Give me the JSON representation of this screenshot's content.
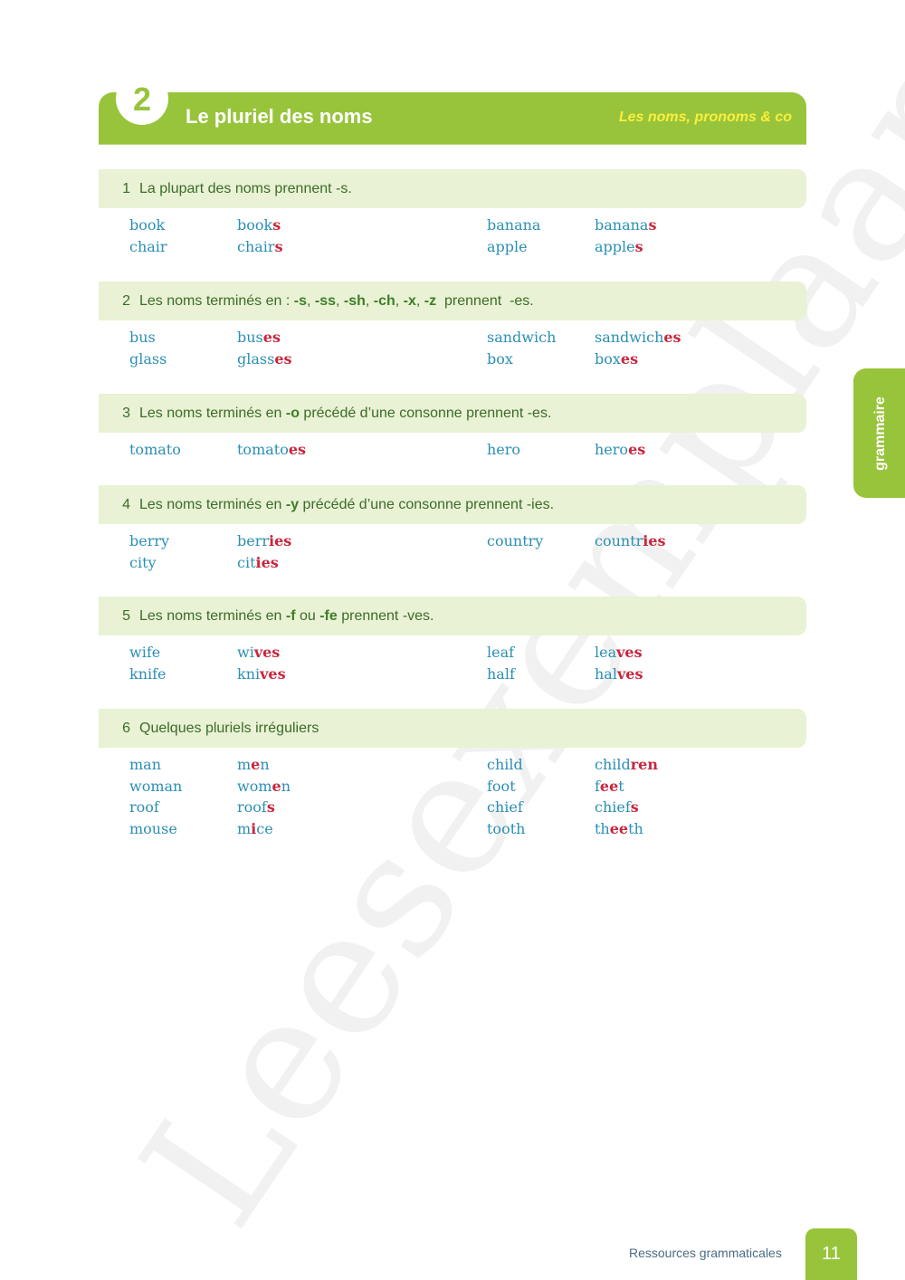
{
  "watermark": "Leesexemplaar",
  "header": {
    "number": "2",
    "title": "Le pluriel des noms",
    "subtitle": "Les noms, pronoms & co"
  },
  "side_tab": "grammaire",
  "sections": [
    {
      "num": "1",
      "rule_parts": [
        {
          "t": "La plupart des noms prennent -s.",
          "b": false
        }
      ],
      "rows": [
        [
          {
            "base": "book"
          },
          {
            "stem": "book",
            "end": "s"
          },
          {
            "base": "banana"
          },
          {
            "stem": "banana",
            "end": "s"
          }
        ],
        [
          {
            "base": "chair"
          },
          {
            "stem": "chair",
            "end": "s"
          },
          {
            "base": "apple"
          },
          {
            "stem": "apple",
            "end": "s"
          }
        ]
      ]
    },
    {
      "num": "2",
      "rule_parts": [
        {
          "t": "Les noms terminés en : ",
          "b": false
        },
        {
          "t": "-s",
          "b": true
        },
        {
          "t": ", ",
          "b": false
        },
        {
          "t": "-ss",
          "b": true
        },
        {
          "t": ", ",
          "b": false
        },
        {
          "t": "-sh",
          "b": true
        },
        {
          "t": ", ",
          "b": false
        },
        {
          "t": "-ch",
          "b": true
        },
        {
          "t": ", ",
          "b": false
        },
        {
          "t": "-x",
          "b": true
        },
        {
          "t": ", ",
          "b": false
        },
        {
          "t": "-z",
          "b": true
        },
        {
          "t": "  prennent  -es.",
          "b": false
        }
      ],
      "rows": [
        [
          {
            "base": "bus"
          },
          {
            "stem": "bus",
            "end": "es"
          },
          {
            "base": "sandwich"
          },
          {
            "stem": "sandwich",
            "end": "es"
          }
        ],
        [
          {
            "base": "glass"
          },
          {
            "stem": "glass",
            "end": "es"
          },
          {
            "base": "box"
          },
          {
            "stem": "box",
            "end": "es"
          }
        ]
      ]
    },
    {
      "num": "3",
      "rule_parts": [
        {
          "t": "Les noms terminés en ",
          "b": false
        },
        {
          "t": "-o",
          "b": true
        },
        {
          "t": " précédé d’une consonne prennent -es.",
          "b": false
        }
      ],
      "rows": [
        [
          {
            "base": "tomato"
          },
          {
            "stem": "tomato",
            "end": "es"
          },
          {
            "base": "hero"
          },
          {
            "stem": "hero",
            "end": "es"
          }
        ]
      ]
    },
    {
      "num": "4",
      "rule_parts": [
        {
          "t": "Les noms terminés en ",
          "b": false
        },
        {
          "t": "-y",
          "b": true
        },
        {
          "t": " précédé d’une consonne prennent -ies.",
          "b": false
        }
      ],
      "rows": [
        [
          {
            "base": "berry"
          },
          {
            "stem": "berr",
            "end": "ies"
          },
          {
            "base": "country"
          },
          {
            "stem": "countr",
            "end": "ies"
          }
        ],
        [
          {
            "base": "city"
          },
          {
            "stem": "cit",
            "end": "ies"
          },
          null,
          null
        ]
      ]
    },
    {
      "num": "5",
      "rule_parts": [
        {
          "t": "Les noms terminés en ",
          "b": false
        },
        {
          "t": "-f",
          "b": true
        },
        {
          "t": " ou ",
          "b": false
        },
        {
          "t": "-fe",
          "b": true
        },
        {
          "t": " prennent -ves.",
          "b": false
        }
      ],
      "rows": [
        [
          {
            "base": "wife"
          },
          {
            "stem": "wi",
            "end": "ves"
          },
          {
            "base": "leaf"
          },
          {
            "stem": "lea",
            "end": "ves"
          }
        ],
        [
          {
            "base": "knife"
          },
          {
            "stem": "kni",
            "end": "ves"
          },
          {
            "base": "half"
          },
          {
            "stem": "hal",
            "end": "ves"
          }
        ]
      ]
    },
    {
      "num": "6",
      "rule_parts": [
        {
          "t": "Quelques pluriels irréguliers",
          "b": false
        }
      ],
      "rows": [
        [
          {
            "base": "man"
          },
          {
            "stem": "m",
            "end": "e",
            "after": "n"
          },
          {
            "base": "child"
          },
          {
            "stem": "child",
            "end": "ren"
          }
        ],
        [
          {
            "base": "woman"
          },
          {
            "stem": "wom",
            "end": "e",
            "after": "n"
          },
          {
            "base": "foot"
          },
          {
            "stem": "f",
            "end": "ee",
            "after": "t"
          }
        ],
        [
          {
            "base": "roof"
          },
          {
            "stem": "roof",
            "end": "s"
          },
          {
            "base": "chief"
          },
          {
            "stem": "chief",
            "end": "s"
          }
        ],
        [
          {
            "base": "mouse"
          },
          {
            "stem": "m",
            "end": "i",
            "after": "ce"
          },
          {
            "base": "tooth"
          },
          {
            "stem": "th",
            "end": "ee",
            "after": "th"
          }
        ]
      ]
    }
  ],
  "footer": {
    "label": "Ressources grammaticales",
    "page": "11"
  },
  "colors": {
    "accent_green": "#98c43b",
    "rule_bg": "#e9f2d4",
    "word_blue": "#2b8fb5",
    "ending_red": "#c8263e",
    "subtitle_yellow": "#fbee3c"
  }
}
